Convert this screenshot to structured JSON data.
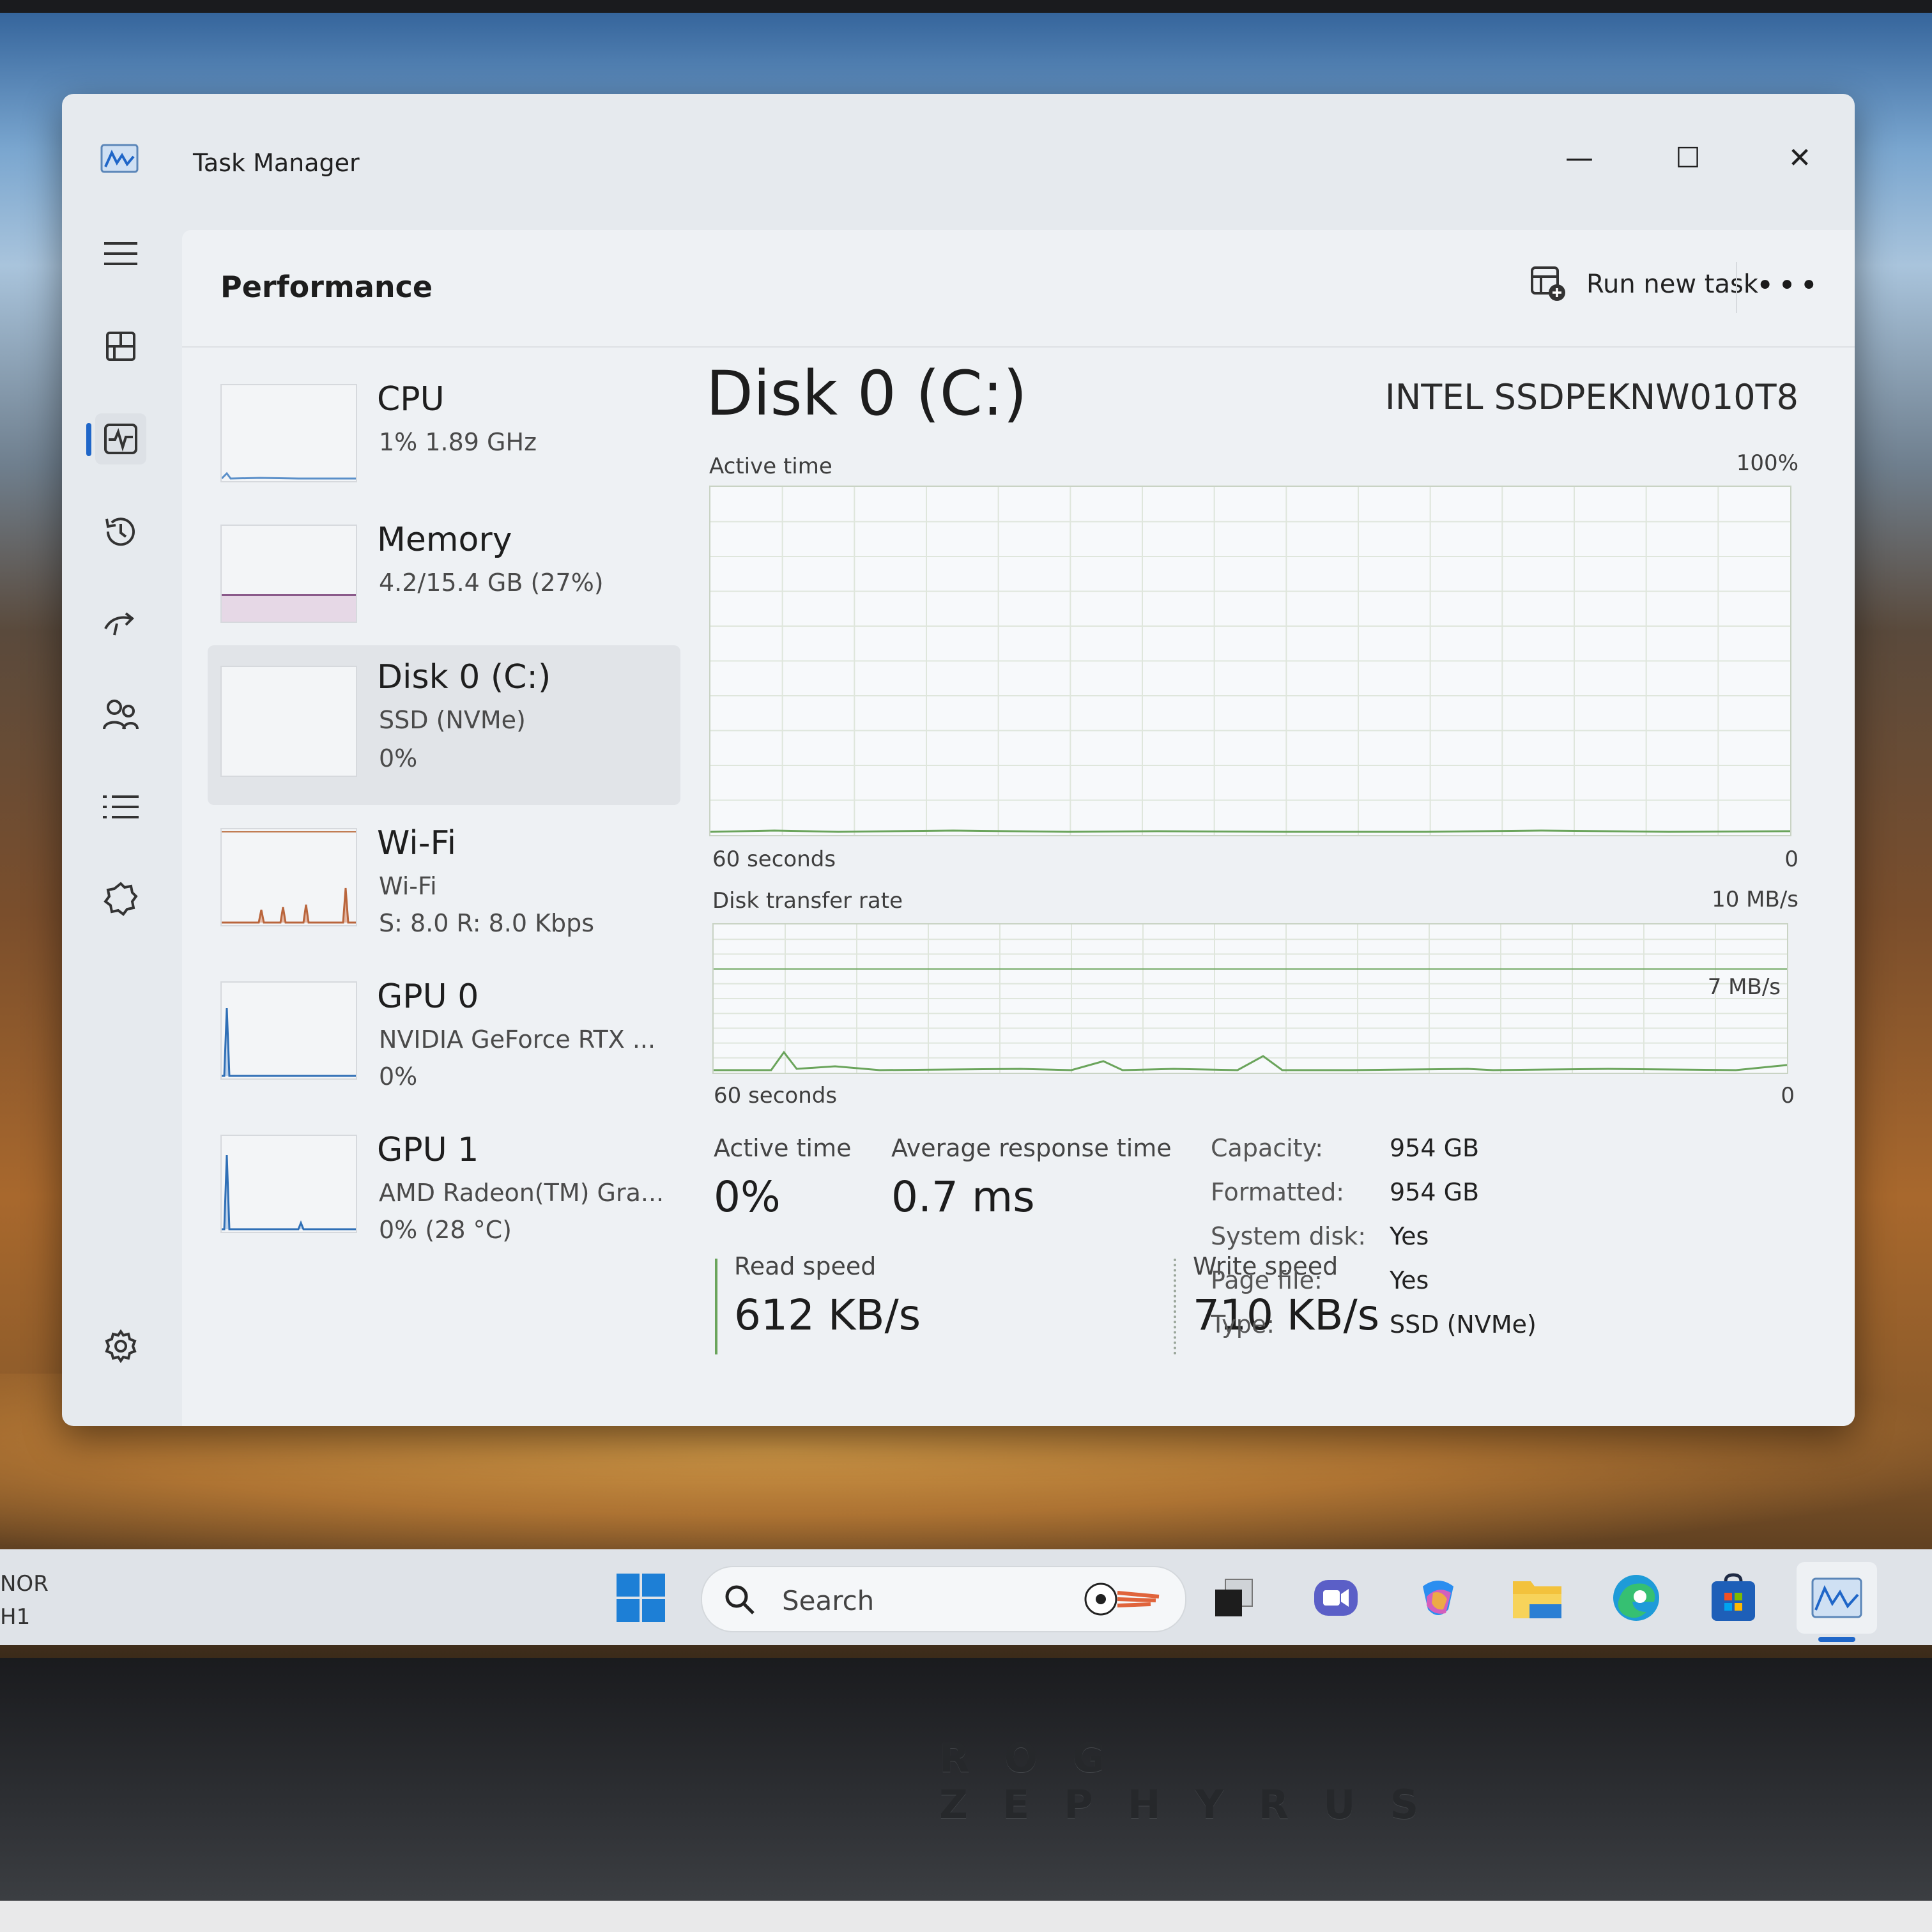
{
  "window": {
    "title": "Task Manager",
    "minimize_glyph": "—",
    "maximize_glyph": "☐",
    "close_glyph": "✕"
  },
  "header": {
    "page_title": "Performance",
    "run_task_label": "Run new task",
    "more_glyph": "•••"
  },
  "rail": {
    "items": [
      "hamburger-menu-icon",
      "processes-icon",
      "performance-icon",
      "app-history-icon",
      "startup-apps-icon",
      "users-icon",
      "details-icon",
      "services-icon",
      "settings-icon"
    ]
  },
  "sidebar": {
    "items": [
      {
        "name": "CPU",
        "sub1": "1%  1.89 GHz",
        "sub2": ""
      },
      {
        "name": "Memory",
        "sub1": "4.2/15.4 GB (27%)",
        "sub2": ""
      },
      {
        "name": "Disk 0 (C:)",
        "sub1": "SSD (NVMe)",
        "sub2": "0%"
      },
      {
        "name": "Wi-Fi",
        "sub1": "Wi-Fi",
        "sub2": "S: 8.0  R: 8.0 Kbps"
      },
      {
        "name": "GPU 0",
        "sub1": "NVIDIA GeForce RTX ...",
        "sub2": "0%"
      },
      {
        "name": "GPU 1",
        "sub1": "AMD Radeon(TM) Gra...",
        "sub2": "0%  (28 °C)"
      }
    ],
    "memory_used_fraction": 0.27
  },
  "main": {
    "title": "Disk 0 (C:)",
    "model": "INTEL SSDPEKNW010T8",
    "active_time_graph": {
      "label": "Active time",
      "max_label": "100%",
      "time_label": "60 seconds",
      "min_label": "0"
    },
    "transfer_graph": {
      "label": "Disk transfer rate",
      "max_label": "10 MB/s",
      "line_label": "7 MB/s",
      "line_fraction": 0.7,
      "time_label": "60 seconds",
      "min_label": "0"
    },
    "stats": {
      "active_time_label": "Active time",
      "active_time_value": "0%",
      "avg_response_label": "Average response time",
      "avg_response_value": "0.7 ms",
      "read_speed_label": "Read speed",
      "read_speed_value": "612 KB/s",
      "write_speed_label": "Write speed",
      "write_speed_value": "710 KB/s"
    },
    "properties": [
      {
        "label": "Capacity:",
        "value": "954 GB"
      },
      {
        "label": "Formatted:",
        "value": "954 GB"
      },
      {
        "label": "System disk:",
        "value": "Yes"
      },
      {
        "label": "Page file:",
        "value": "Yes"
      },
      {
        "label": "Type:",
        "value": "SSD (NVMe)"
      }
    ]
  },
  "taskbar": {
    "left_line1": "NOR",
    "left_line2": "H1",
    "search_placeholder": "Search",
    "icons": [
      "start-icon",
      "task-view-icon",
      "teams-icon",
      "copilot-icon",
      "file-explorer-icon",
      "edge-icon",
      "store-icon",
      "task-manager-icon"
    ]
  },
  "device_brand": "ROG ZEPHYRUS",
  "colors": {
    "accent": "#1f66c8",
    "disk_graph": "#6aa45b"
  }
}
